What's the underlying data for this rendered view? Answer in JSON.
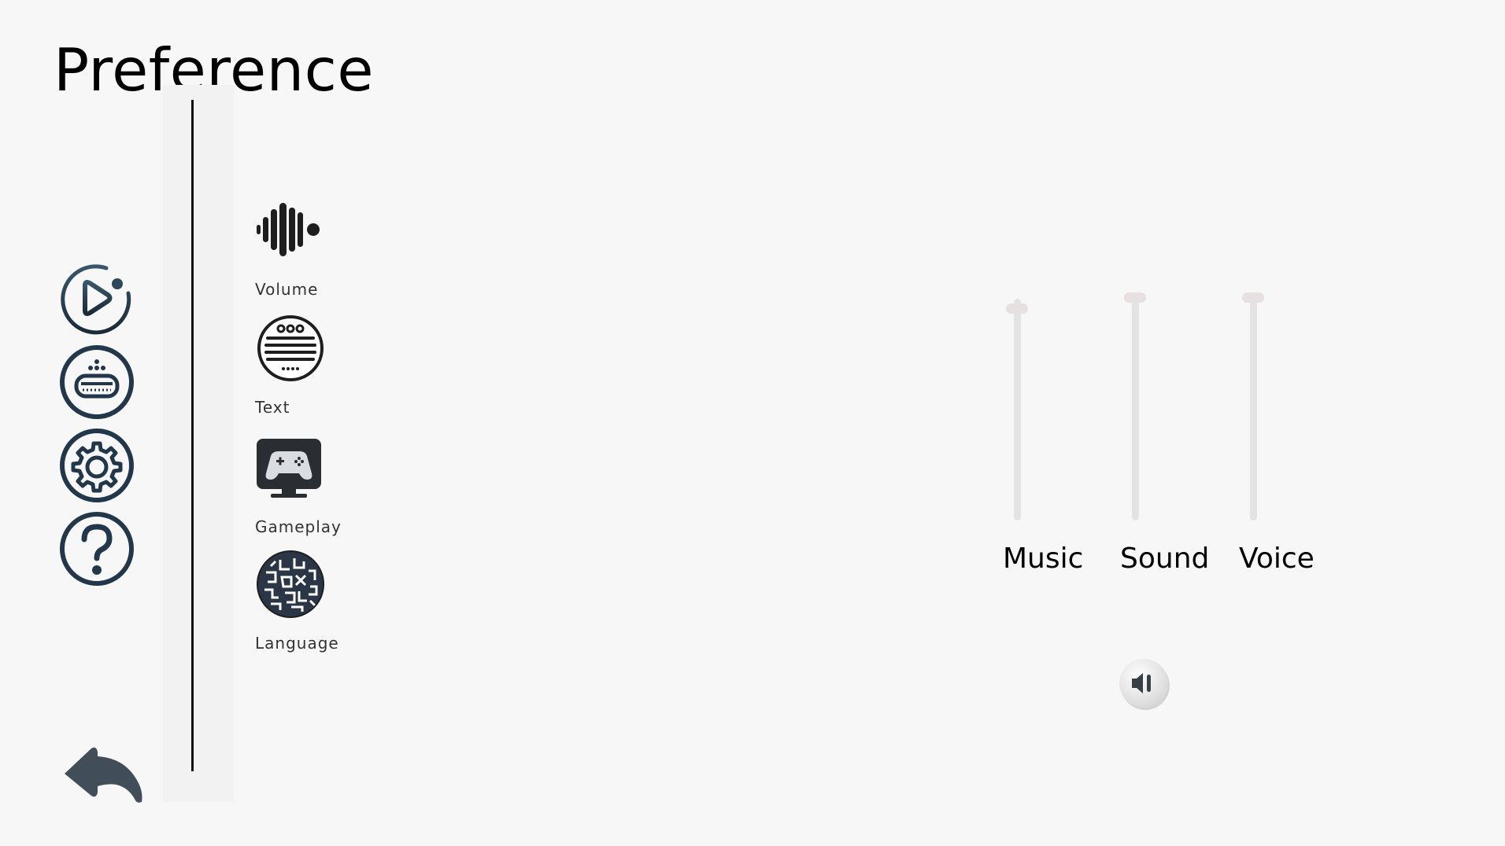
{
  "screen": {
    "title": "Preference"
  },
  "nav": {
    "items": [
      {
        "name": "play",
        "icon": "play-circle-icon"
      },
      {
        "name": "save-load",
        "icon": "keyboard-tray-icon"
      },
      {
        "name": "settings",
        "icon": "gear-icon"
      },
      {
        "name": "help",
        "icon": "question-icon"
      }
    ],
    "back_icon": "back-arrow-icon"
  },
  "categories": [
    {
      "label": "Volume",
      "icon": "sound-wave-icon"
    },
    {
      "label": "Text",
      "icon": "text-lines-icon"
    },
    {
      "label": "Gameplay",
      "icon": "gamepad-monitor-icon"
    },
    {
      "label": "Language",
      "icon": "language-pattern-icon"
    }
  ],
  "volume": {
    "sliders": [
      {
        "label": "Music",
        "level": 0.95
      },
      {
        "label": "Sound",
        "level": 1.0
      },
      {
        "label": "Voice",
        "level": 1.0
      }
    ],
    "mute_icon": "speaker-icon"
  },
  "colors": {
    "background": "#f7f7f7",
    "icon_dark": "#243a4c",
    "track": "#e3e3e3",
    "thumb": "#e6e0e0"
  }
}
